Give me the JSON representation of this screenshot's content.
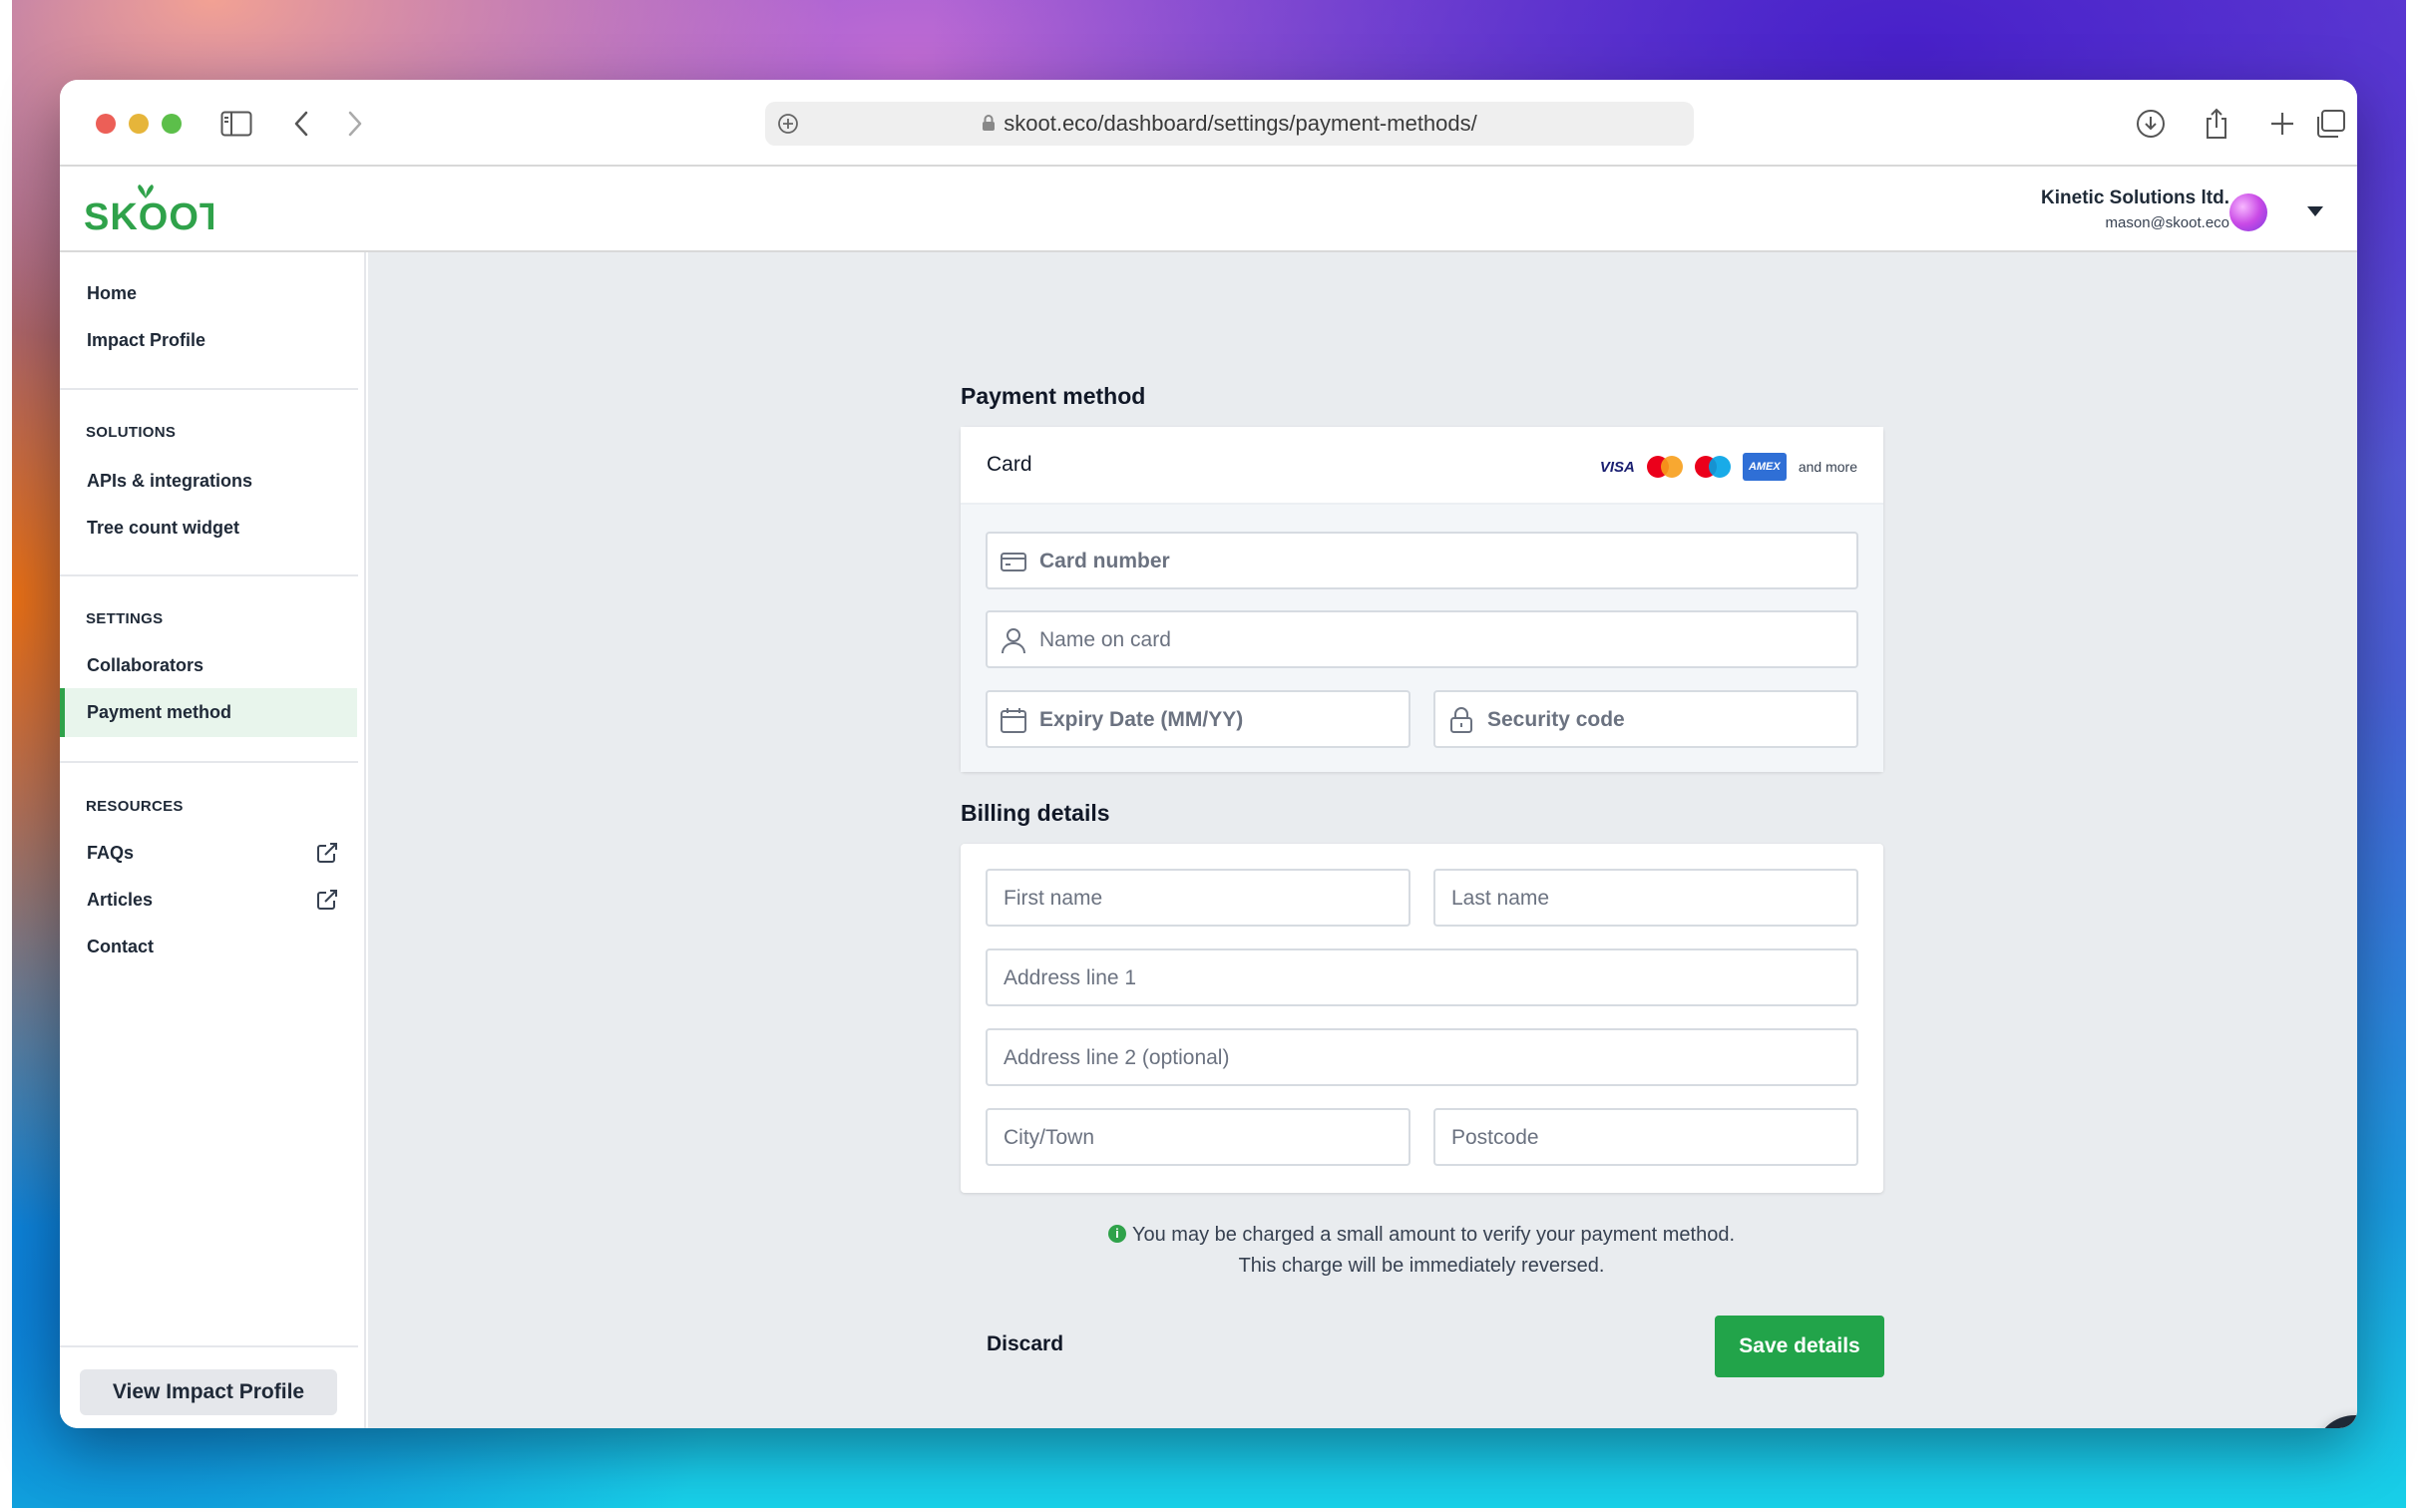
{
  "browser": {
    "url": "skoot.eco/dashboard/settings/payment-methods/"
  },
  "header": {
    "logo_text": "SKOOT",
    "org_name": "Kinetic Solutions ltd.",
    "user_email": "mason@skoot.eco"
  },
  "sidebar": {
    "top_items": [
      {
        "label": "Home"
      },
      {
        "label": "Impact Profile"
      }
    ],
    "solutions": {
      "title": "SOLUTIONS",
      "items": [
        {
          "label": "APIs & integrations"
        },
        {
          "label": "Tree count widget"
        }
      ]
    },
    "settings": {
      "title": "SETTINGS",
      "items": [
        {
          "label": "Collaborators"
        },
        {
          "label": "Payment method",
          "active": true
        }
      ]
    },
    "resources": {
      "title": "RESOURCES",
      "items": [
        {
          "label": "FAQs",
          "external": true
        },
        {
          "label": "Articles",
          "external": true
        },
        {
          "label": "Contact"
        }
      ]
    },
    "view_profile_button": "View Impact Profile"
  },
  "payment": {
    "title": "Payment method",
    "card_label": "Card",
    "brands": {
      "visa": "VISA",
      "amex": "AMEX",
      "more": "and more"
    },
    "card_number_placeholder": "Card number",
    "name_on_card_placeholder": "Name on card",
    "expiry_placeholder": "Expiry Date (MM/YY)",
    "security_code_placeholder": "Security code"
  },
  "billing": {
    "title": "Billing details",
    "first_name_placeholder": "First name",
    "last_name_placeholder": "Last name",
    "address1_placeholder": "Address line 1",
    "address2_placeholder": "Address line 2 (optional)",
    "city_placeholder": "City/Town",
    "postcode_placeholder": "Postcode"
  },
  "notice": {
    "line1": "You may be charged a small amount to verify your payment method.",
    "line2": "This charge will be immediately reversed."
  },
  "actions": {
    "discard": "Discard",
    "save": "Save details"
  },
  "colors": {
    "brand_green": "#22a44a",
    "active_bg": "#e8f5ec",
    "main_bg": "#e9ecef"
  }
}
